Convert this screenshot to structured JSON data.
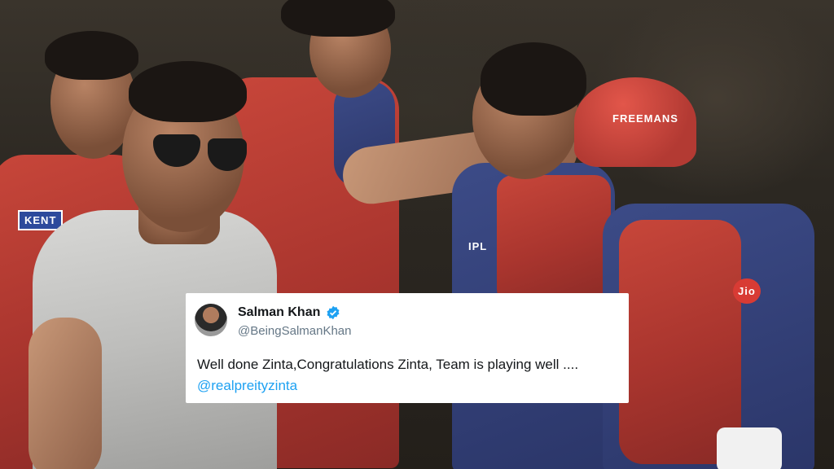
{
  "tweet": {
    "name": "Salman Khan",
    "handle": "@BeingSalmanKhan",
    "text": "Well done Zinta,Congratulations Zinta, Team is playing well ....",
    "mention": "@realpreityzinta"
  },
  "photo": {
    "sponsors": [
      "KENT",
      "FREEMANS",
      "Jio",
      "IPL"
    ]
  },
  "colors": {
    "mention_blue": "#1da1f2",
    "verified_blue": "#1da1f2"
  },
  "icons": [
    "verified-badge-icon"
  ]
}
